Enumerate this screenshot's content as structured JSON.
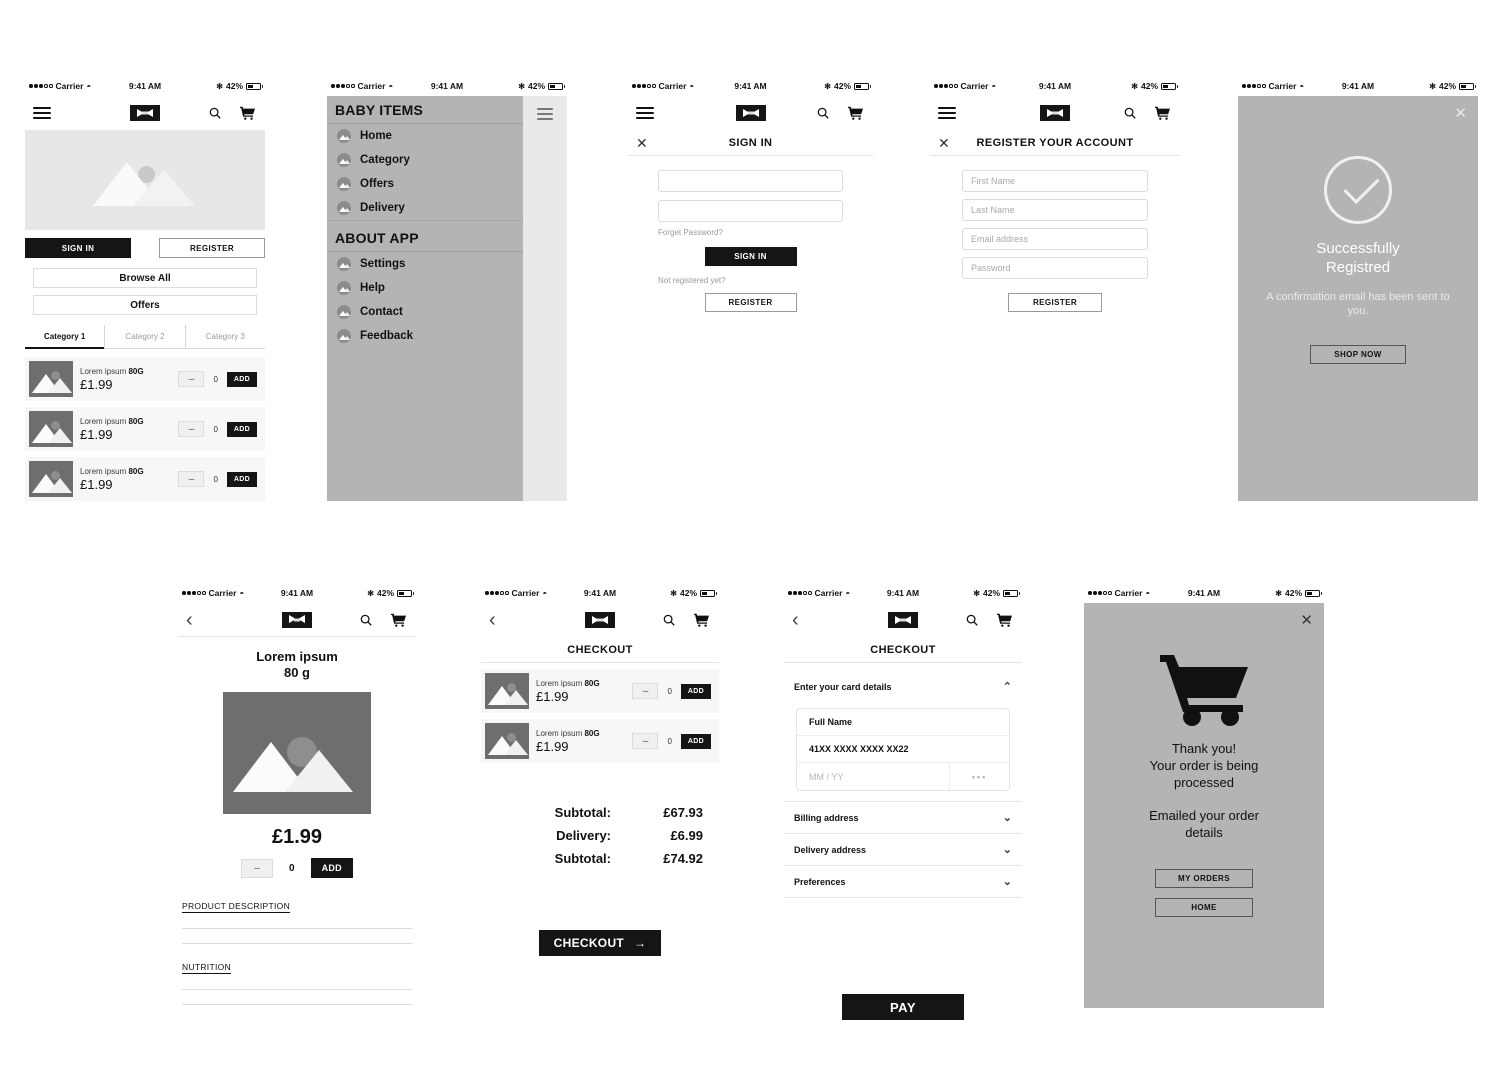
{
  "status_bar": {
    "carrier": "Carrier",
    "time": "9:41 AM",
    "battery": "42%"
  },
  "brand": {
    "logo_name": "app-logo"
  },
  "screen_home": {
    "buttons": {
      "sign_in": "SIGN IN",
      "register": "REGISTER",
      "browse_all": "Browse All",
      "offers": "Offers"
    },
    "tabs": [
      "Category 1",
      "Category 2",
      "Category 3"
    ],
    "active_tab": "Category 1",
    "products": [
      {
        "name": "Lorem ipsum ",
        "weight": "80G",
        "price": "£1.99",
        "qty": "0",
        "add": "ADD",
        "minus": "–"
      },
      {
        "name": "Lorem ipsum ",
        "weight": "80G",
        "price": "£1.99",
        "qty": "0",
        "add": "ADD",
        "minus": "–"
      },
      {
        "name": "Lorem ipsum ",
        "weight": "80G",
        "price": "£1.99",
        "qty": "0",
        "add": "ADD",
        "minus": "–"
      }
    ]
  },
  "screen_menu": {
    "section_one_title": "BABY ITEMS",
    "section_one_items": [
      "Home",
      "Category",
      "Offers",
      "Delivery"
    ],
    "section_two_title": "ABOUT APP",
    "section_two_items": [
      "Settings",
      "Help",
      "Contact",
      "Feedback"
    ]
  },
  "screen_signin": {
    "title": "SIGN IN",
    "close": "✕",
    "email_value": "",
    "password_value": "",
    "forgot_password": "Forget Password?",
    "sign_in_button": "SIGN IN",
    "not_registered": "Not registered yet?",
    "register_button": "REGISTER"
  },
  "screen_register": {
    "title": "REGISTER YOUR ACCOUNT",
    "close": "✕",
    "fields": [
      "First Name",
      "Last Name",
      "Email address",
      "Password"
    ],
    "register_button": "REGISTER"
  },
  "screen_success": {
    "close": "✕",
    "title_line1": "Successfully",
    "title_line2": "Registred",
    "subtitle": "A confirmation email has been sent to you.",
    "button": "SHOP NOW"
  },
  "screen_product": {
    "title_line1": "Lorem ipsum",
    "title_line2": "80 g",
    "price": "£1.99",
    "minus": "–",
    "qty": "0",
    "add": "ADD",
    "description_heading": "PRODUCT DESCRIPTION",
    "nutrition_heading": "NUTRITION"
  },
  "screen_cart": {
    "title": "CHECKOUT",
    "products": [
      {
        "name": "Lorem ipsum ",
        "weight": "80G",
        "price": "£1.99",
        "qty": "0",
        "add": "ADD",
        "minus": "–"
      },
      {
        "name": "Lorem ipsum ",
        "weight": "80G",
        "price": "£1.99",
        "qty": "0",
        "add": "ADD",
        "minus": "–"
      }
    ],
    "totals": [
      {
        "label": "Subtotal:",
        "value": "£67.93"
      },
      {
        "label": "Delivery:",
        "value": "£6.99"
      },
      {
        "label": "Subtotal:",
        "value": "£74.92"
      }
    ],
    "checkout_button": "CHECKOUT",
    "checkout_arrow": "→"
  },
  "screen_payment": {
    "title": "CHECKOUT",
    "card_section_label": "Enter your card details",
    "card_section_chevron": "⌃",
    "full_name": "Full Name",
    "card_number": "41XX XXXX XXXX XX22",
    "expiry_placeholder": "MM / YY",
    "cvv_placeholder": "•••",
    "sections": [
      "Billing address",
      "Delivery address",
      "Preferences"
    ],
    "section_chevron": "⌄",
    "pay_button": "PAY"
  },
  "screen_thanks": {
    "close": "✕",
    "line1": "Thank you!",
    "line2": "Your order is being",
    "line3": "processed",
    "line4": "Emailed your order",
    "line5": "details",
    "my_orders_button": "MY ORDERS",
    "home_button": "HOME"
  },
  "colors": {
    "dark": "#151515",
    "overlay_gray": "#b4b4b4",
    "thumb_gray": "#6e6e6e",
    "hero_gray": "#e7e7e7",
    "row_gray": "#f7f7f7"
  }
}
